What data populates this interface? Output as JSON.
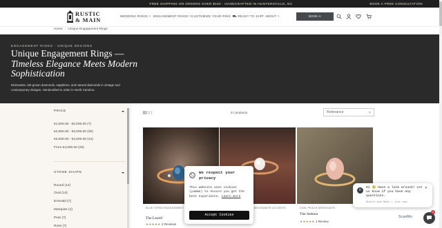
{
  "announcement": {
    "message": "FREE SHIPPING ON ORDERS OVER $150 · HANDCRAFTED IN HUNTERSVILLE, NC",
    "cta": "BOOK A FREE CONSULTATION"
  },
  "header": {
    "logo_line1": "RUSTIC",
    "logo_line2": "& MAIN",
    "nav": [
      "WEDDING RINGS",
      "ENGAGEMENT RINGS",
      "CUSTOMIZE YOUR RING",
      "READY TO SHIP",
      "ABOUT"
    ],
    "consult_button": "BOOK A CONSULTATION",
    "icons": [
      "search-icon",
      "account-icon",
      "wishlist-icon",
      "cart-icon"
    ]
  },
  "breadcrumb": {
    "home": "Home",
    "current": "Unique Engagement Rings"
  },
  "hero": {
    "eyebrow": "ENGAGEMENT RINGS · UNIQUE DESIGNS",
    "title_line1": "Unique Engagement Rings —",
    "title_line2": "Timeless Elegance Meets Modern",
    "title_line3": "Sophistication",
    "description": "Moissanite, lab-grown diamonds, sapphires, and natural diamonds in vintage and contemporary designs. Handcrafted to order in North Carolina."
  },
  "filters": {
    "price_title": "PRICE",
    "price_options": [
      "€1,000.00 - €2,000.00 (7)",
      "€2,000.00 - €3,000.00 (30)",
      "€3,000.00 - €4,000.00 (44)",
      "From €4,000.00 (29)"
    ],
    "stone_title": "STONE SHAPE",
    "stone_options": [
      "Round (14)",
      "Oval (14)",
      "Emerald (7)",
      "Marquise (4)",
      "Pear (7)",
      "Rose (7)"
    ]
  },
  "toolbar": {
    "count": "47 products",
    "sort": "Relevance"
  },
  "products": [
    {
      "tag": "BLUE TOPAZ ENGAGEMENT & ACCENTS",
      "name": "The Laurel",
      "stars": "★★★★★",
      "reviews": "2 Reviews"
    },
    {
      "tag": "MOISSANITE ACCENTS",
      "name": "",
      "stars": "",
      "reviews": ""
    },
    {
      "tag": "OVAL PEACH MORGANITE",
      "name": "The Sedona",
      "stars": "★★★★★",
      "reviews": "1 Review"
    }
  ],
  "cookie": {
    "title": "We respect your privacy",
    "text": "This website uses cookies (yumme) to ensure you get the best experience.",
    "learn_more": "Learn more",
    "accept": "Accept Cookies"
  },
  "chat": {
    "avatar": "R",
    "message": "Hi 😊 Have a look around! Let us know if you have any questions.",
    "meta": "Rustic and Main • Just now",
    "badge": "1",
    "brand": "ScanMu"
  },
  "colors": {
    "dark": "#2a2a2a",
    "accent": "#b58a4c",
    "cream": "#f9f6f1"
  }
}
